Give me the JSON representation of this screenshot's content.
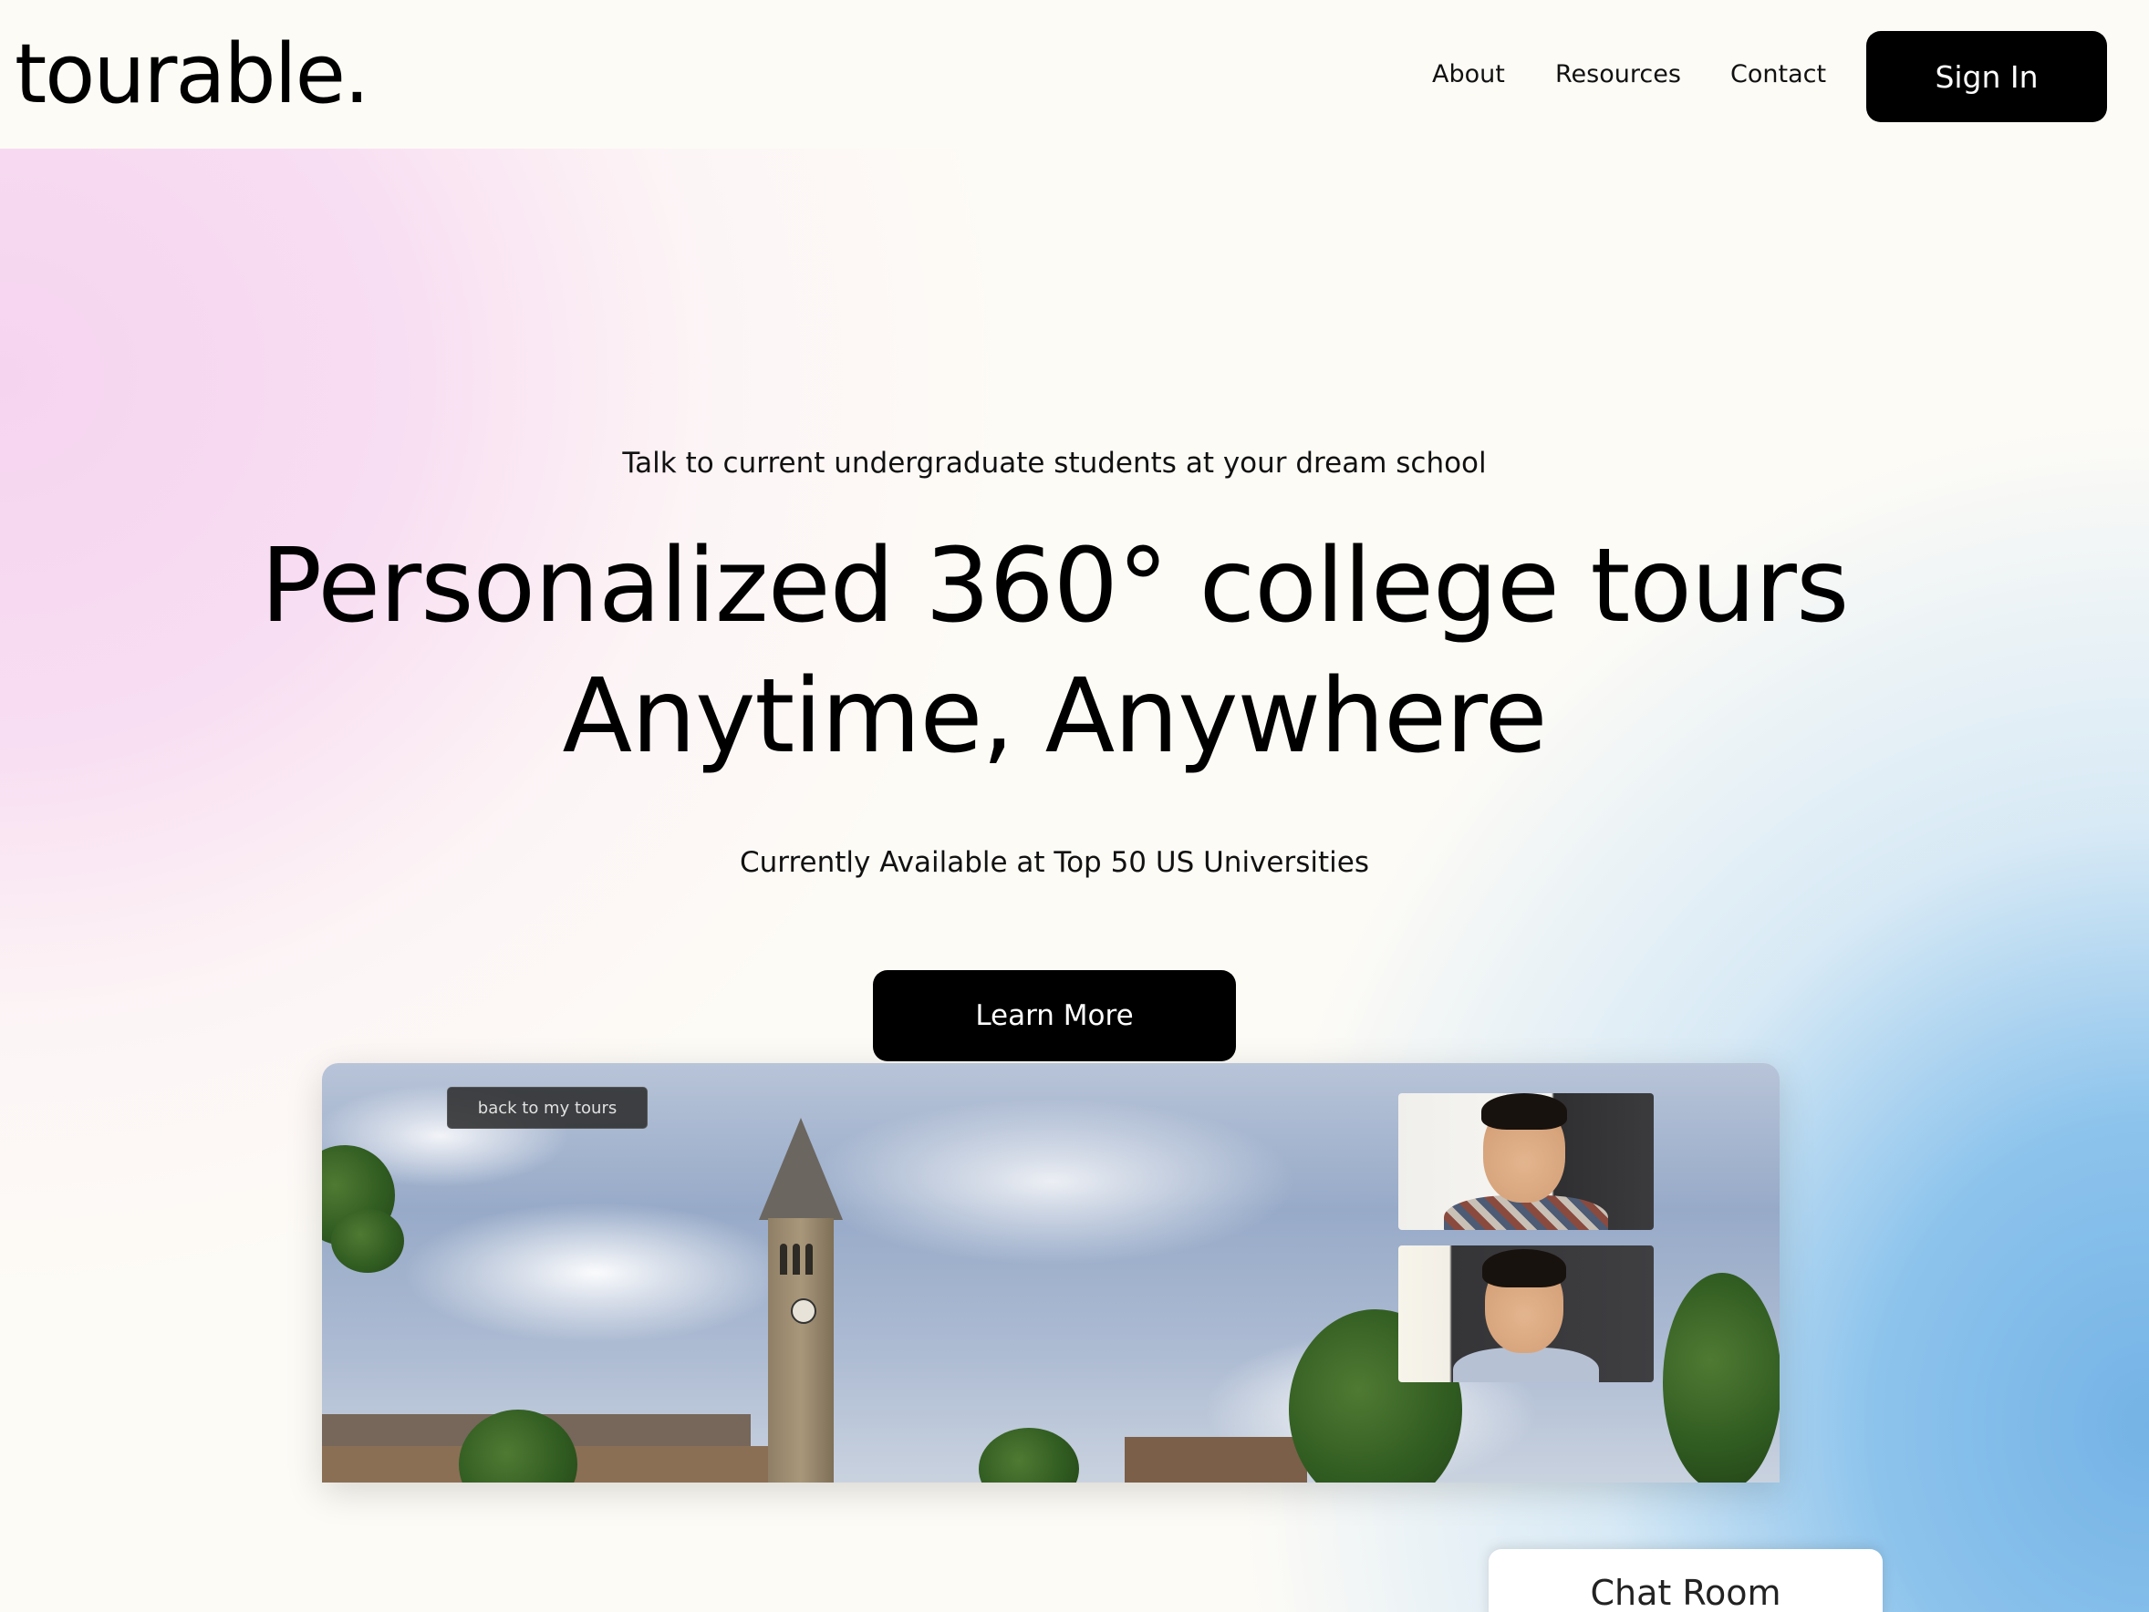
{
  "header": {
    "logo": "tourable.",
    "nav": {
      "about": "About",
      "resources": "Resources",
      "contact": "Contact"
    },
    "sign_in": "Sign In"
  },
  "hero": {
    "tagline": "Talk to current undergraduate students at your dream school",
    "headline_line1": "Personalized 360° college tours",
    "headline_line2": "Anytime, Anywhere",
    "availability": "Currently Available at Top 50 US Universities",
    "cta": "Learn More"
  },
  "preview": {
    "back_button": "back to my tours",
    "chat_room": "Chat Room"
  },
  "colors": {
    "background": "#fdfbf6",
    "pink_glow": "#f5d4ef",
    "blue_glow": "#75b3e6",
    "button": "#000000",
    "button_text": "#ffffff"
  },
  "icons": {
    "participant_1": "video-participant",
    "participant_2": "video-participant"
  }
}
